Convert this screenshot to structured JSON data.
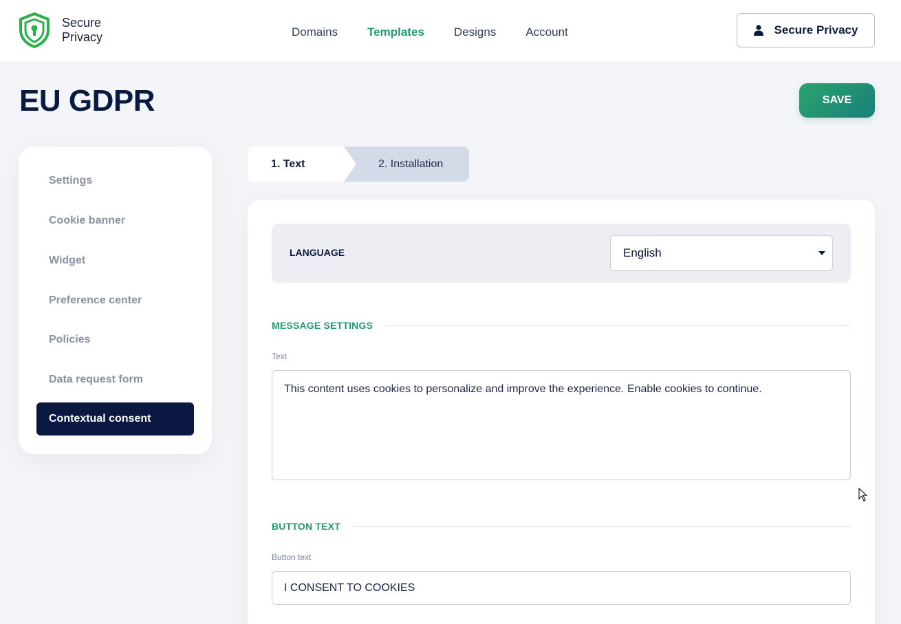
{
  "brand": {
    "line1": "Secure",
    "line2": "Privacy"
  },
  "nav": {
    "items": [
      {
        "label": "Domains",
        "active": false
      },
      {
        "label": "Templates",
        "active": true
      },
      {
        "label": "Designs",
        "active": false
      },
      {
        "label": "Account",
        "active": false
      }
    ]
  },
  "account_button": {
    "label": "Secure Privacy",
    "icon": "user-icon"
  },
  "page": {
    "title": "EU GDPR",
    "save_label": "SAVE"
  },
  "sidebar": {
    "items": [
      {
        "label": "Settings"
      },
      {
        "label": "Cookie banner"
      },
      {
        "label": "Widget"
      },
      {
        "label": "Preference center"
      },
      {
        "label": "Policies"
      },
      {
        "label": "Data request form"
      },
      {
        "label": "Contextual consent",
        "active": true
      }
    ]
  },
  "steps": [
    {
      "label": "1. Text",
      "active": true
    },
    {
      "label": "2. Installation",
      "active": false
    }
  ],
  "language": {
    "label": "LANGUAGE",
    "selected": "English"
  },
  "message_settings": {
    "heading": "MESSAGE SETTINGS",
    "field_label": "Text",
    "value": "This content uses cookies to personalize and improve the experience. Enable cookies to continue."
  },
  "button_text": {
    "heading": "BUTTON TEXT",
    "field_label": "Button text",
    "value": "I CONSENT TO COOKIES"
  },
  "colors": {
    "accent": "#1f9a72",
    "navy": "#0a1842",
    "save_gradient_start": "#2aa36d",
    "save_gradient_end": "#1a7f7a"
  }
}
